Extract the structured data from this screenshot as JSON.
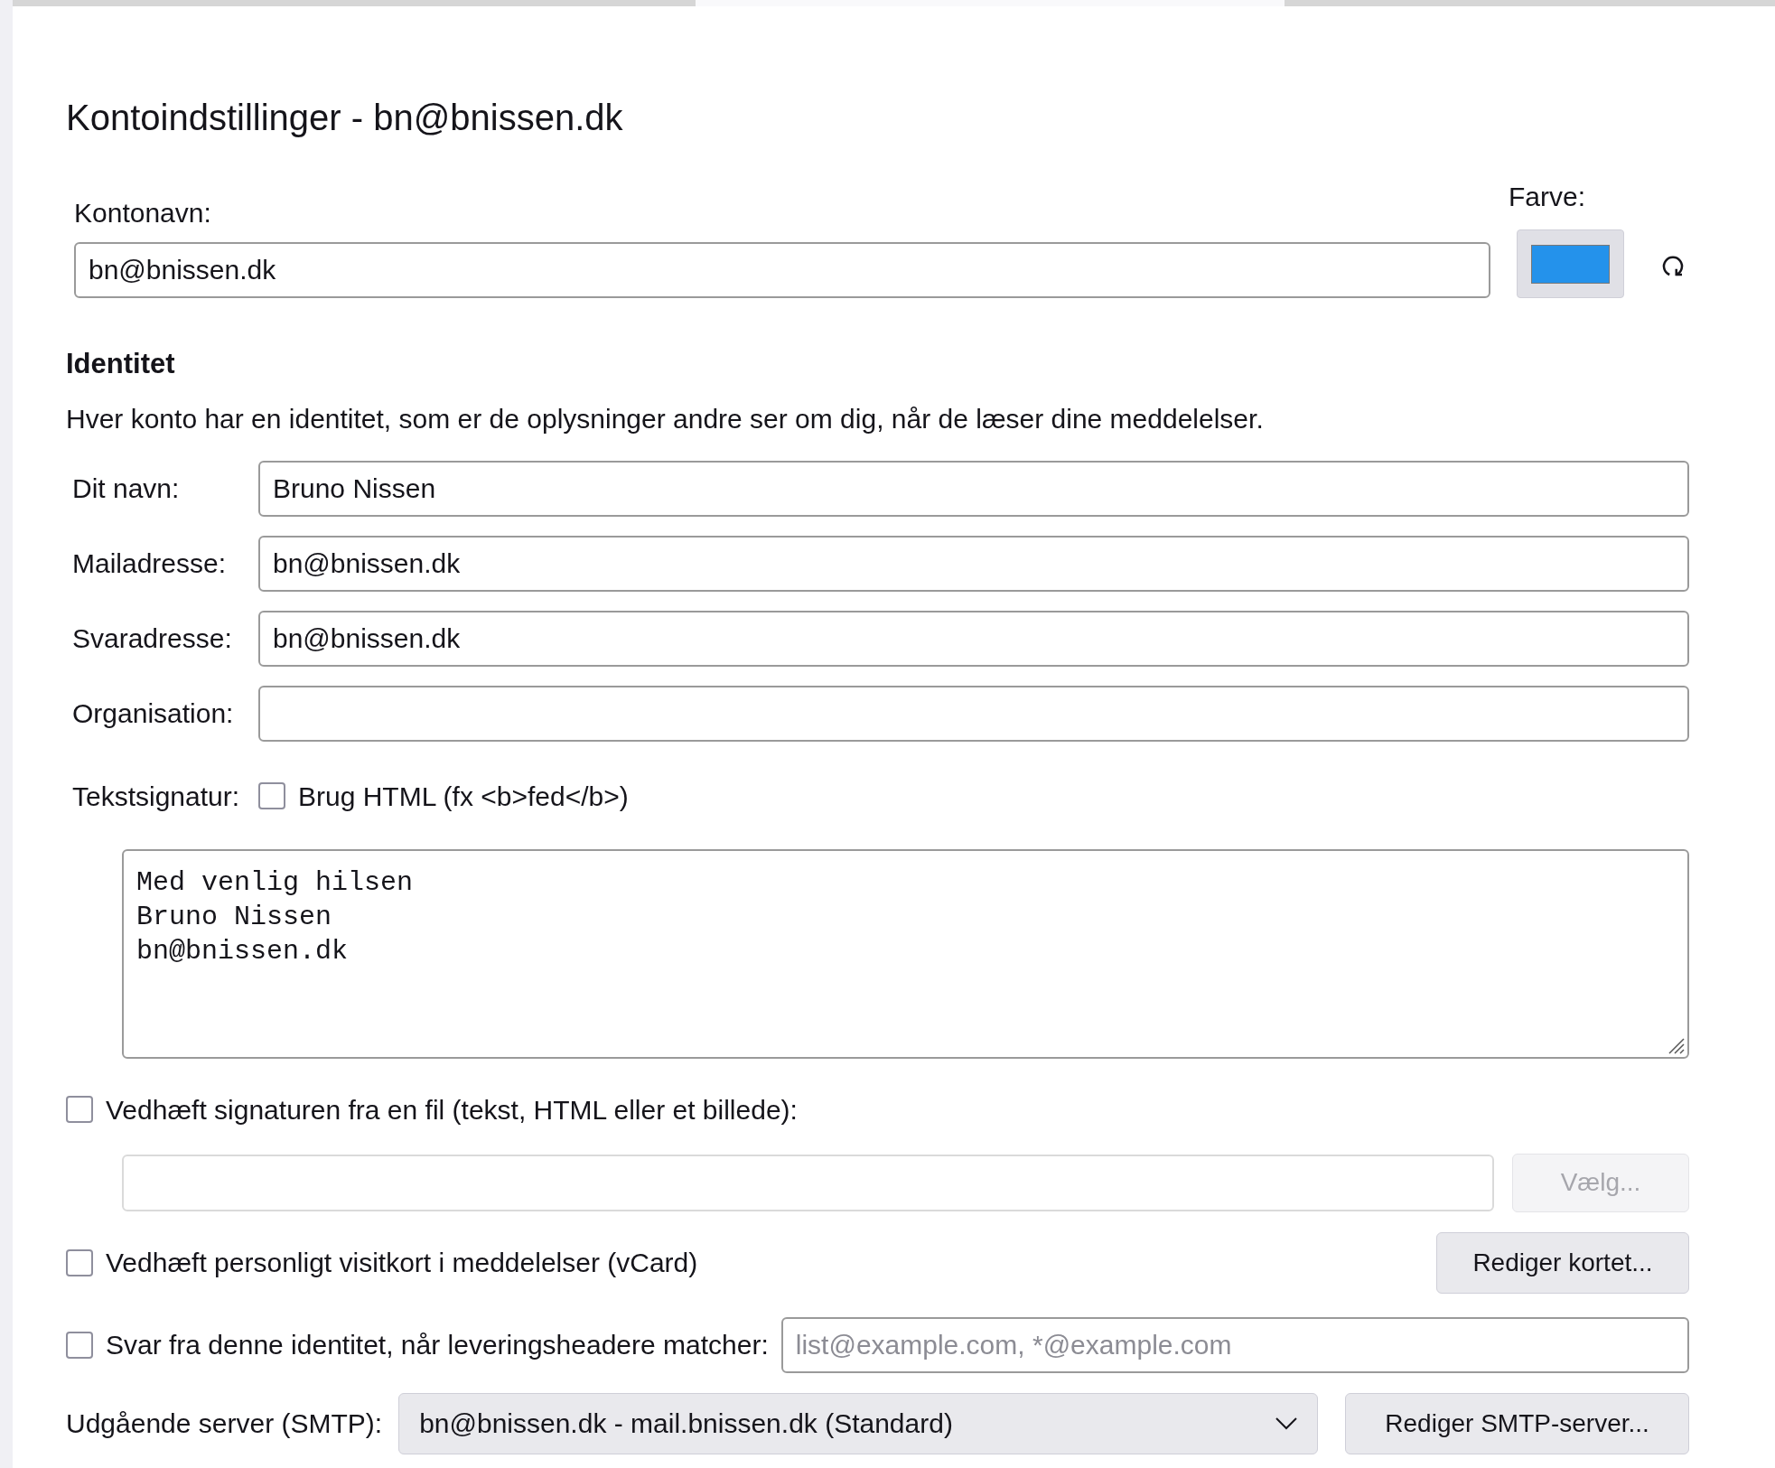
{
  "title": "Kontoindstillinger - bn@bnissen.dk",
  "account_name": {
    "label": "Kontonavn:",
    "value": "bn@bnissen.dk"
  },
  "color": {
    "label": "Farve:",
    "color": "#2492eb"
  },
  "identity": {
    "heading": "Identitet",
    "description": "Hver konto har en identitet, som er de oplysninger andre ser om dig, når de læser dine meddelelser.",
    "fields": [
      {
        "label": "Dit navn:",
        "value": "Bruno Nissen"
      },
      {
        "label": "Mailadresse:",
        "value": "bn@bnissen.dk"
      },
      {
        "label": "Svaradresse:",
        "value": "bn@bnissen.dk"
      },
      {
        "label": "Organisation:"
      }
    ]
  },
  "signature": {
    "label": "Tekstsignatur:",
    "html_checkbox": {
      "label": "Brug HTML (fx <b>fed</b>)",
      "checked": false
    },
    "lines": [
      "Med venlig hilsen",
      "Bruno Nissen",
      "bn@bnissen.dk"
    ]
  },
  "attach_file": {
    "label": "Vedhæft signaturen fra en fil (tekst, HTML eller et billede):",
    "checked": false,
    "button": {
      "label": "Vælg...",
      "disabled": true
    }
  },
  "vcard": {
    "label": "Vedhæft personligt visitkort i meddelelser (vCard)",
    "checked": false,
    "button": "Rediger kortet..."
  },
  "reply_match": {
    "label": "Svar fra denne identitet, når leveringsheadere matcher:",
    "checked": false,
    "placeholder": "list@example.com, *@example.com"
  },
  "smtp": {
    "label": "Udgående server (SMTP):",
    "value": "bn@bnissen.dk - mail.bnissen.dk (Standard)",
    "button": "Rediger SMTP-server..."
  }
}
